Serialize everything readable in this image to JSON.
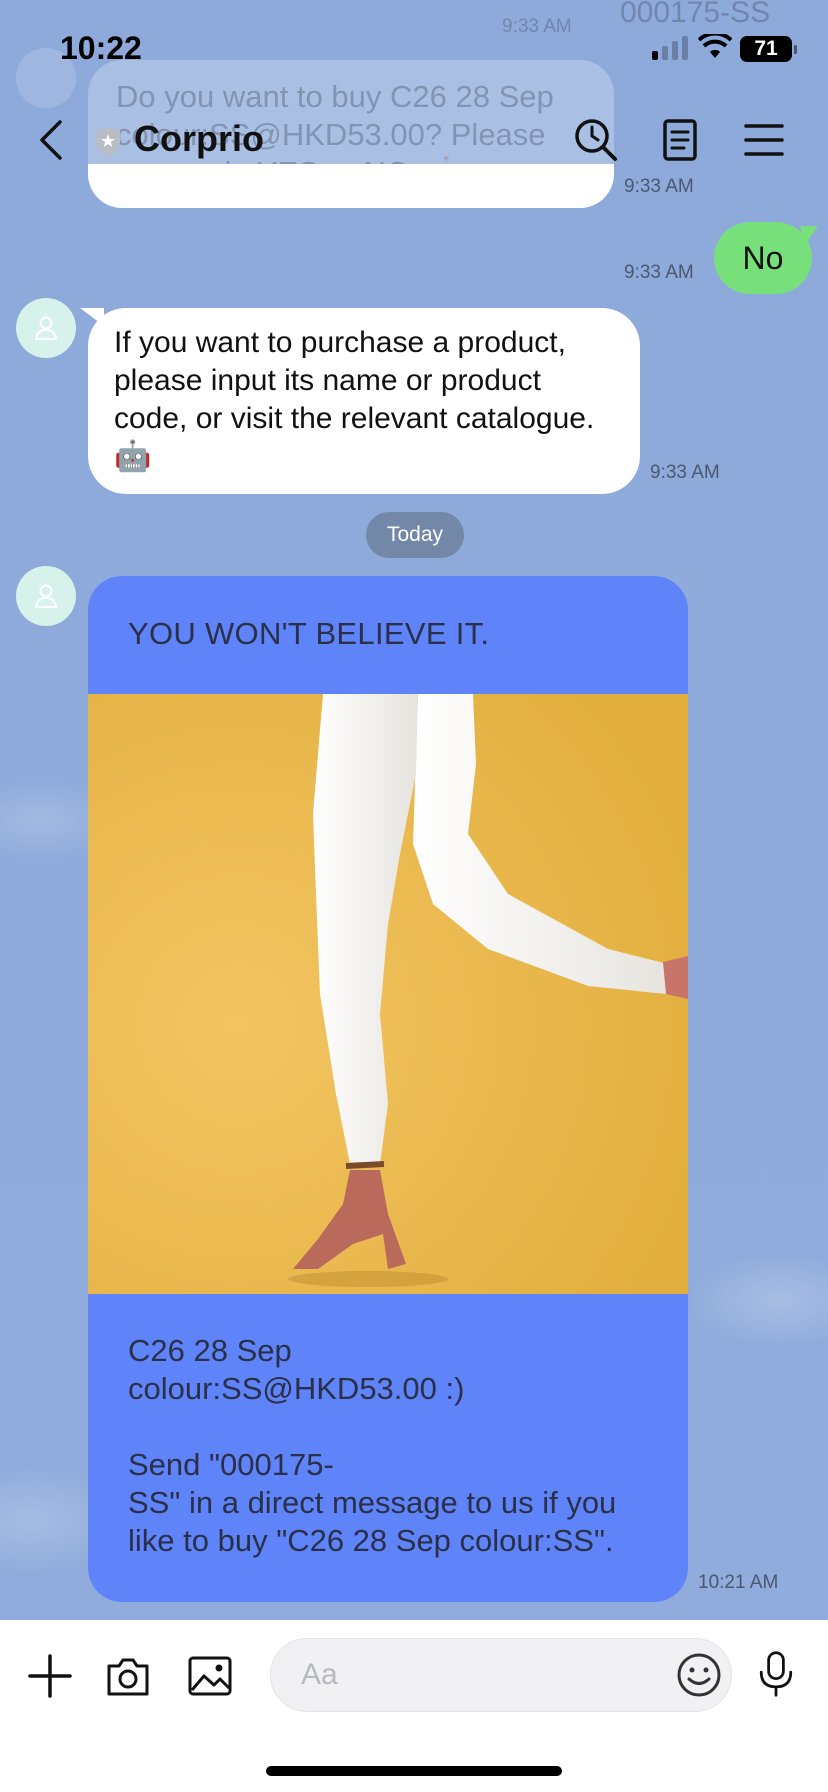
{
  "status_bar": {
    "time": "10:22",
    "battery": "71"
  },
  "header": {
    "title": "Corprio"
  },
  "ghost_message": {
    "line1": "Do you want to buy C26 28 Sep",
    "line2": "colour:SS@HKD53.00? Please",
    "line3": "answer in YES or NO. 🤖",
    "code_fragment": "000175-SS",
    "time": "9:33 AM"
  },
  "messages": {
    "prev_bubble_time": "9:33 AM",
    "sent": {
      "text": "No",
      "time": "9:33 AM"
    },
    "received": {
      "text": "If you want to purchase a product, please input its name or product code, or visit the relevant catalogue. 🤖",
      "time": "9:33 AM"
    },
    "date_divider": "Today",
    "card": {
      "title": "YOU WON'T BELIEVE IT.",
      "body": "C26 28 Sep\ncolour:SS@HKD53.00 :)\n\nSend \"000175-\nSS\" in a direct message to us if you like to buy \"C26 28 Sep colour:SS\".",
      "time": "10:21 AM",
      "image_alt": "product photo: legs in white trousers and pink suede heels on yellow background"
    }
  },
  "input_bar": {
    "placeholder": "Aa"
  },
  "colors": {
    "chat_bg": "#8fabd9",
    "sent_bubble": "#77e07a",
    "card_bg": "#5f83f8",
    "image_bg": "#e8b94a"
  }
}
